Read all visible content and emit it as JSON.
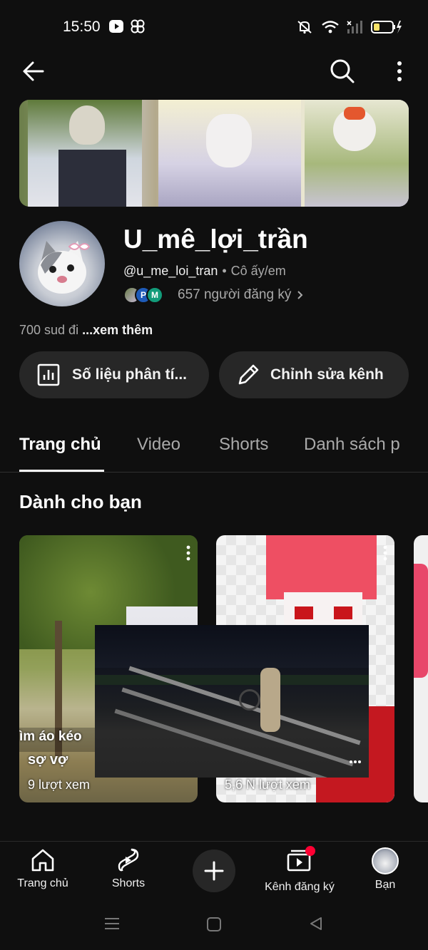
{
  "status_bar": {
    "time": "15:50"
  },
  "channel": {
    "name": "U_mê_lợi_trần",
    "handle": "@u_me_loi_tran",
    "pronouns": "Cô ấy/em",
    "subscribers": "657 người đăng ký",
    "subscriber_avatar_letters": [
      "",
      "P",
      "M"
    ],
    "description": "700 sud đi",
    "see_more": "...xem thêm"
  },
  "actions": {
    "analytics_label": "Số liệu phân tí...",
    "edit_label": "Chỉnh sửa kênh"
  },
  "tabs": [
    {
      "label": "Trang chủ",
      "active": true
    },
    {
      "label": "Video",
      "active": false
    },
    {
      "label": "Shorts",
      "active": false
    },
    {
      "label": "Danh sách p",
      "active": false
    }
  ],
  "section": {
    "title": "Dành cho bạn"
  },
  "shorts": [
    {
      "title": "sợ vợ",
      "views": "9 lượt xem",
      "overlay_text": "ìm áo kéo"
    },
    {
      "title": "",
      "views": "5,6 N lượt xem"
    }
  ],
  "bottom_nav": [
    {
      "label": "Trang chủ",
      "icon": "home-icon"
    },
    {
      "label": "Shorts",
      "icon": "shorts-icon"
    },
    {
      "label": "",
      "icon": "create-plus-icon"
    },
    {
      "label": "Kênh đăng ký",
      "icon": "subscriptions-icon"
    },
    {
      "label": "Bạn",
      "icon": "you-avatar-icon"
    }
  ],
  "colors": {
    "background": "#0f0f0f",
    "surface": "#272727",
    "text_primary": "#f1f1f1",
    "text_secondary": "#aaaaaa",
    "notification_dot": "#ff0033",
    "battery_fill": "#f6e36a"
  }
}
